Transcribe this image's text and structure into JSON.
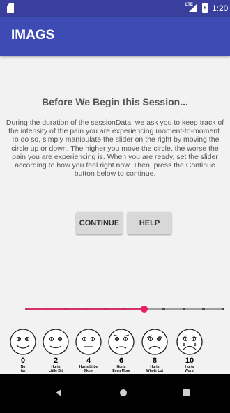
{
  "status_bar": {
    "network": "LTE",
    "time": "1:20"
  },
  "app_bar": {
    "title": "IMAGS"
  },
  "content": {
    "heading": "Before We Begin this Session...",
    "body": "During the duration of the sessionData, we ask you to keep track of the intensity of the pain you are experiencing moment-to-moment.\nTo do so, simply manipulate the slider on the right by moving the circle up or down. The higher you move the circle, the worse the pain you are experiencing is. When you are ready, set the slider according to how you feel right now. Then, press the Continue button below to continue.",
    "continue_label": "CONTINUE",
    "help_label": "HELP"
  },
  "slider": {
    "steps": 10,
    "value": 6
  },
  "scale": [
    {
      "score": "0",
      "label": "No\nHurt"
    },
    {
      "score": "2",
      "label": "Hurts\nLittle Bit"
    },
    {
      "score": "4",
      "label": "Hurts Little\nMore"
    },
    {
      "score": "6",
      "label": "Hurts\nEven More"
    },
    {
      "score": "8",
      "label": "Hurts\nWhole Lot"
    },
    {
      "score": "10",
      "label": "Hurts\nWorst"
    }
  ],
  "icons": {
    "status": [
      "sd-card-icon",
      "signal-icon",
      "battery-icon"
    ],
    "nav": [
      "back-icon",
      "home-icon",
      "recents-icon"
    ],
    "faces": [
      "face-no-hurt-icon",
      "face-hurts-little-bit-icon",
      "face-hurts-little-more-icon",
      "face-hurts-even-more-icon",
      "face-hurts-whole-lot-icon",
      "face-hurts-worst-icon"
    ]
  },
  "colors": {
    "status_bar": "#3a3e9c",
    "app_bar": "#3f4bb5",
    "accent": "#e91e63"
  }
}
